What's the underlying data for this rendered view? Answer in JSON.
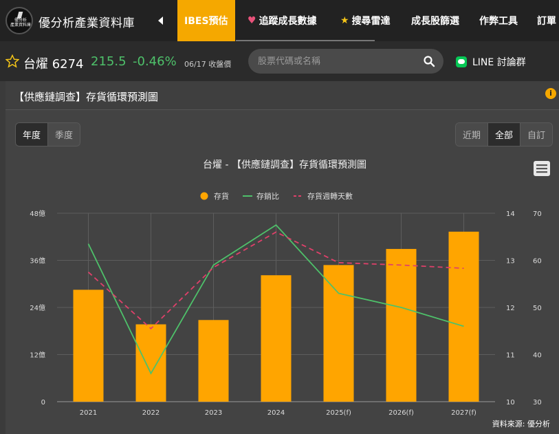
{
  "site": {
    "title": "優分析產業資料庫",
    "logo_text": "優分析\n產業資料庫"
  },
  "nav": {
    "items": [
      {
        "label": "IBES預估",
        "icon": "",
        "active": true
      },
      {
        "label": "追蹤成長數據",
        "icon": "heart-icon",
        "active": false
      },
      {
        "label": "搜尋雷達",
        "icon": "star-icon",
        "active": false
      },
      {
        "label": "成長股篩選",
        "icon": "",
        "active": false
      },
      {
        "label": "作弊工具",
        "icon": "",
        "active": false
      },
      {
        "label": "訂單",
        "icon": "",
        "active": false
      }
    ]
  },
  "stock": {
    "name": "台燿 6274",
    "price": "215.5",
    "change": "-0.46%",
    "date": "06/17 收盤價",
    "price_color": "#4ec16a"
  },
  "search": {
    "placeholder": "股票代碼或名稱"
  },
  "line_link": {
    "label": "LINE 討論群"
  },
  "panel": {
    "title": "【供應鏈調查】存貨循環預測圖",
    "info": "i"
  },
  "period_toggle": {
    "options": [
      "年度",
      "季度"
    ],
    "selected": "年度"
  },
  "range_toggle": {
    "options": [
      "近期",
      "全部",
      "自訂"
    ],
    "selected": "全部"
  },
  "chart_data": {
    "type": "bar",
    "title": "台燿 - 【供應鏈調查】存貨循環預測圖",
    "categories": [
      "2021",
      "2022",
      "2023",
      "2024",
      "2025(f)",
      "2026(f)",
      "2027(f)"
    ],
    "series": [
      {
        "name": "存貨",
        "kind": "bar",
        "axis": "left",
        "color": "#ffa500",
        "values": [
          28.5,
          19.7,
          20.8,
          32.2,
          34.8,
          38.9,
          43.3
        ]
      },
      {
        "name": "存銷比",
        "kind": "line",
        "axis": "right-inner",
        "color": "#4ec16a",
        "values": [
          13.35,
          10.6,
          12.9,
          13.75,
          12.3,
          12.0,
          11.6
        ]
      },
      {
        "name": "存貨週轉天數",
        "kind": "dashed-line",
        "axis": "right-outer",
        "color": "#e0406a",
        "values": [
          57.5,
          45.5,
          58.5,
          66.0,
          59.5,
          59.0,
          58.3
        ]
      }
    ],
    "left_axis": {
      "ticks": [
        "0",
        "12億",
        "24億",
        "36億",
        "48億"
      ],
      "ylim": [
        0,
        48
      ]
    },
    "right_inner_axis": {
      "ticks": [
        "10",
        "11",
        "12",
        "13",
        "14"
      ],
      "ylim": [
        10,
        14
      ]
    },
    "right_outer_axis": {
      "ticks": [
        "30",
        "40",
        "50",
        "60",
        "70"
      ],
      "ylim": [
        30,
        70
      ]
    },
    "legend_position": "top-center",
    "grid": true,
    "source": "資料來源: 優分析"
  }
}
